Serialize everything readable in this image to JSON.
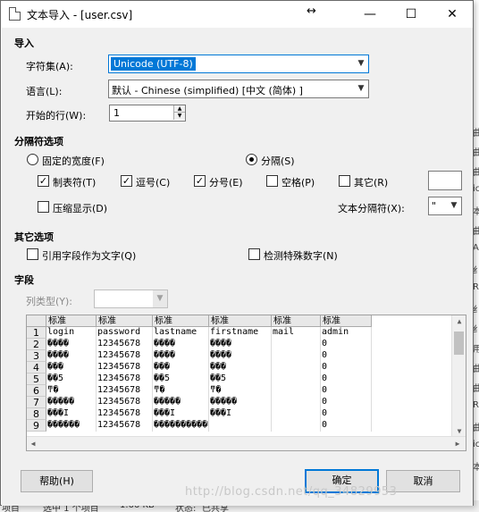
{
  "dialog": {
    "title": "文本导入 - [user.csv]",
    "move_glyph": "↔",
    "minimize": "—",
    "maximize": "☐",
    "close": "✕"
  },
  "import": {
    "section": "导入",
    "charset_label": "字符集(A):",
    "charset_value": "Unicode (UTF-8)",
    "language_label": "语言(L):",
    "language_value": "默认 - Chinese (simplified) [中文 (简体) ]",
    "start_row_label": "开始的行(W):",
    "start_row_value": "1"
  },
  "separator": {
    "section": "分隔符选项",
    "fixed_width": "固定的宽度(F)",
    "separated": "分隔(S)",
    "selected_mode": "separated",
    "tab": "制表符(T)",
    "tab_checked": true,
    "comma": "逗号(C)",
    "comma_checked": true,
    "semicolon": "分号(E)",
    "semicolon_checked": true,
    "space": "空格(P)",
    "space_checked": false,
    "other": "其它(R)",
    "other_checked": false,
    "merge": "压缩显示(D)",
    "merge_checked": false,
    "text_delimiter_label": "文本分隔符(X):",
    "text_delimiter_value": "\""
  },
  "other_options": {
    "section": "其它选项",
    "quoted_as_text": "引用字段作为文字(Q)",
    "detect_special_numbers": "检测特殊数字(N)"
  },
  "fields": {
    "section": "字段",
    "column_type_label": "列类型(Y):",
    "column_type_value": ""
  },
  "preview": {
    "columns": [
      "标准",
      "标准",
      "标准",
      "标准",
      "标准",
      "标准"
    ],
    "rows": [
      [
        "login",
        "password",
        "lastname",
        "firstname",
        "mail",
        "admin"
      ],
      [
        "����",
        "12345678",
        "����",
        "����",
        "",
        "0"
      ],
      [
        "����",
        "12345678",
        "����",
        "����",
        "",
        "0"
      ],
      [
        "���",
        "12345678",
        "���",
        "���",
        "",
        "0"
      ],
      [
        "��5",
        "12345678",
        "��5",
        "��5",
        "",
        "0"
      ],
      [
        "ͳ�",
        "12345678",
        "ͳ�",
        "ͳ�",
        "",
        "0"
      ],
      [
        "�����",
        "12345678",
        "�����",
        "�����",
        "",
        "0"
      ],
      [
        "���Ϊ",
        "12345678",
        "���Ϊ",
        "���Ϊ",
        "",
        "0"
      ],
      [
        "������",
        "12345678",
        "�����������",
        "",
        "",
        "0"
      ]
    ]
  },
  "buttons": {
    "help": "帮助(H)",
    "ok": "确定",
    "cancel": "取消"
  },
  "background": {
    "status_left": "项目",
    "status_selected": "选中 1 个项目",
    "status_size": "1.66 KB",
    "status_state": "状态:",
    "status_shared": "已共享",
    "left_frags": [
      "F",
      "下",
      "阳",
      "计",
      "阳",
      "阳"
    ],
    "right_frags": [
      "曲",
      "曲",
      "曲",
      "ic",
      "本",
      "曲",
      "AF",
      "纟",
      "R",
      "纟",
      "纟",
      "用",
      "曲",
      "曲",
      "R",
      "曲",
      "ic",
      "本"
    ],
    "watermark": "http://blog.csdn.net/qq_34829953"
  }
}
